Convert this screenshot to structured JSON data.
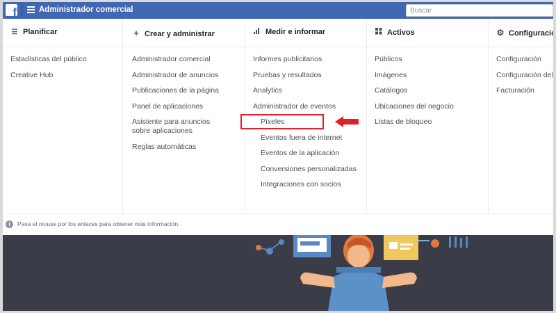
{
  "topbar": {
    "logo_letter": "f",
    "app_title": "Administrador comercial",
    "search_placeholder": "Buscar"
  },
  "columns": [
    {
      "icon": "list-icon",
      "title": "Planificar",
      "items": [
        "Estadísticas del público",
        "Creative Hub"
      ]
    },
    {
      "icon": "plus-icon",
      "title": "Crear y administrar",
      "items": [
        "Administrador comercial",
        "Administrador de anuncios",
        "Publicaciones de la página",
        "Panel de aplicaciones",
        "Asistente para anuncios sobre aplicaciones",
        "Reglas automáticas"
      ]
    },
    {
      "icon": "bar-chart-icon",
      "title": "Medir e informar",
      "items": [
        "Informes publicitarios",
        "Pruebas y resultados",
        "Analytics",
        "Administrador de eventos"
      ],
      "sub_items": [
        "Píxeles",
        "Eventos fuera de internet",
        "Eventos de la aplicación",
        "Conversiones personalizadas",
        "Integraciones con socios"
      ]
    },
    {
      "icon": "grid-icon",
      "title": "Activos",
      "items": [
        "Públicos",
        "Imágenes",
        "Catálogos",
        "Ubicaciones del negocio",
        "Listas de bloqueo"
      ]
    },
    {
      "icon": "gear-icon",
      "title": "Configuración",
      "items": [
        "Configuración",
        "Configuración del n",
        "Facturación"
      ]
    }
  ],
  "footer": {
    "text": "Pasa el mouse por los enlaces para obtener más información."
  },
  "colors": {
    "brand_blue": "#4267b2",
    "highlight_red": "#e0202a",
    "illustration_bg": "#3a3d47"
  }
}
